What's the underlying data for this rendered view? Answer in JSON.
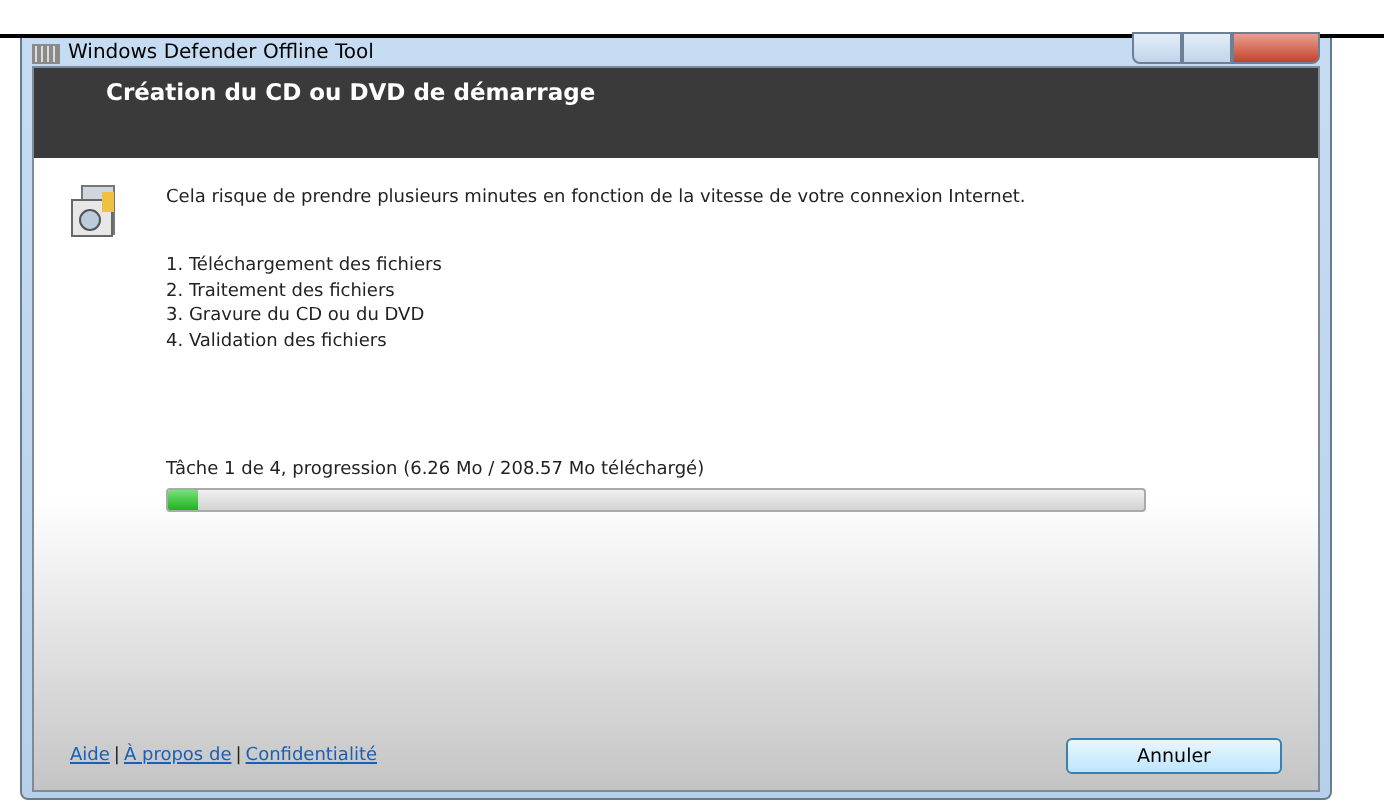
{
  "window": {
    "title": "Windows Defender Offline Tool"
  },
  "header": {
    "title": "Création du CD ou DVD de démarrage"
  },
  "message": "Cela risque de prendre plusieurs minutes en fonction de la vitesse de votre connexion Internet.",
  "steps": [
    "1. Téléchargement des fichiers",
    "2. Traitement des fichiers",
    "3. Gravure du CD ou du DVD",
    "4. Validation des fichiers"
  ],
  "progress": {
    "label": "Tâche 1 de 4, progression (6.26 Mo / 208.57 Mo téléchargé)",
    "level": 0.03
  },
  "footer_links": [
    {
      "label": "Aide"
    },
    {
      "label": "À propos de"
    },
    {
      "label": "Confidentialité"
    }
  ],
  "separator": "|",
  "buttons": [
    "Annuler"
  ]
}
